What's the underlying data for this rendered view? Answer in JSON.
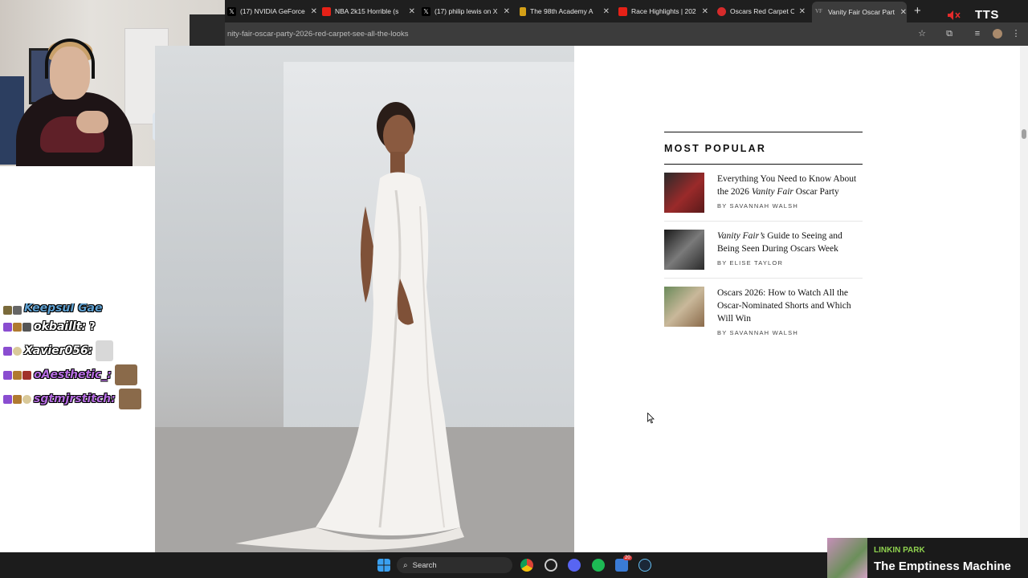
{
  "browser": {
    "tabs": [
      {
        "title": "(17) NVIDIA GeForce",
        "fav_color": "#000000",
        "fav_glyph": "X"
      },
      {
        "title": "NBA 2k15 Horrible (s",
        "fav_color": "#e62117",
        "fav_glyph": ""
      },
      {
        "title": "(17) philip lewis on X",
        "fav_color": "#000000",
        "fav_glyph": "X"
      },
      {
        "title": "The 98th Academy A",
        "fav_color": "#d4a017",
        "fav_glyph": ""
      },
      {
        "title": "Race Highlights | 202",
        "fav_color": "#e62117",
        "fav_glyph": ""
      },
      {
        "title": "Oscars Red Carpet O",
        "fav_color": "#d62b2b",
        "fav_glyph": ""
      },
      {
        "title": "Vanity Fair Oscar Part",
        "fav_color": "#4a4a4a",
        "fav_glyph": "VF",
        "active": true
      }
    ],
    "new_tab": "+",
    "url": "nity-fair-oscar-party-2026-red-carpet-see-all-the-looks",
    "tts_label": "TTS"
  },
  "chat": {
    "partial_top": "Keepsul Gae",
    "messages": [
      {
        "user": "okbaillt:",
        "text": "?",
        "color": "#ffffff",
        "emote": false
      },
      {
        "user": "Xavier056:",
        "text": "",
        "color": "#ffffff",
        "emote": true
      },
      {
        "user": "oAesthetic_:",
        "text": "",
        "color": "#b56de0",
        "emote": true
      },
      {
        "user": "sgtmjrstitch:",
        "text": "",
        "color": "#b56de0",
        "emote": true
      }
    ]
  },
  "most_popular": {
    "heading": "MOST POPULAR",
    "stories": [
      {
        "title_pre": "Everything You Need to Know About the 2026 ",
        "title_em": "Vanity Fair",
        "title_post": " Oscar Party",
        "byline": "BY SAVANNAH WALSH",
        "thumb_color": "#8a2a2a"
      },
      {
        "title_pre": "",
        "title_em": "Vanity Fair’s",
        "title_post": " Guide to Seeing and Being Seen During Oscars Week",
        "byline": "BY ELISE TAYLOR",
        "thumb_color": "#444444"
      },
      {
        "title_pre": "Oscars 2026: How to Watch All the Oscar-Nominated Shorts and Which Will Win",
        "title_em": "",
        "title_post": "",
        "byline": "BY SAVANNAH WALSH",
        "thumb_color": "#9a8a70"
      }
    ]
  },
  "taskbar": {
    "search_label": "Search",
    "badge_count": "20"
  },
  "now_playing": {
    "artist": "LINKIN PARK",
    "track": "The Emptiness Machine"
  }
}
